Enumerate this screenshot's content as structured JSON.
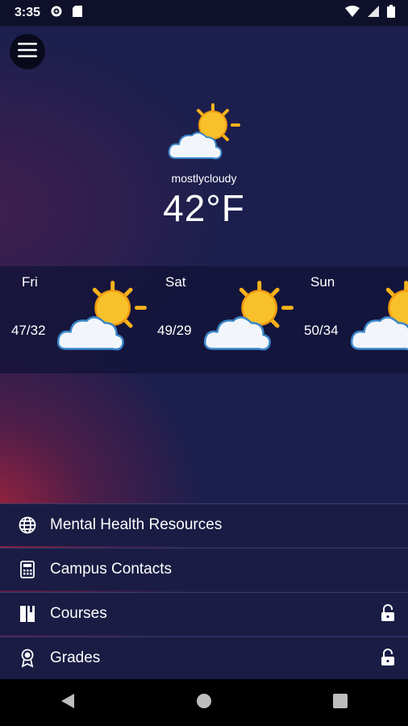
{
  "status_bar": {
    "time": "3:35"
  },
  "current": {
    "condition": "mostlycloudy",
    "temperature": "42°F"
  },
  "forecast": [
    {
      "day": "Fri",
      "temps": "47/32",
      "icon": "partly-cloudy-icon"
    },
    {
      "day": "Sat",
      "temps": "49/29",
      "icon": "partly-cloudy-icon"
    },
    {
      "day": "Sun",
      "temps": "50/34",
      "icon": "partly-cloudy-icon"
    }
  ],
  "menu": {
    "items": [
      {
        "label": "Mental Health Resources",
        "icon": "globe-icon",
        "locked": false
      },
      {
        "label": "Campus Contacts",
        "icon": "calculator-icon",
        "locked": false
      },
      {
        "label": "Courses",
        "icon": "book-icon",
        "locked": true
      },
      {
        "label": "Grades",
        "icon": "award-icon",
        "locked": true
      }
    ]
  },
  "colors": {
    "background": "#1c1f4d",
    "accent_glow": "#b2243a",
    "sun": "#f6b21b"
  }
}
